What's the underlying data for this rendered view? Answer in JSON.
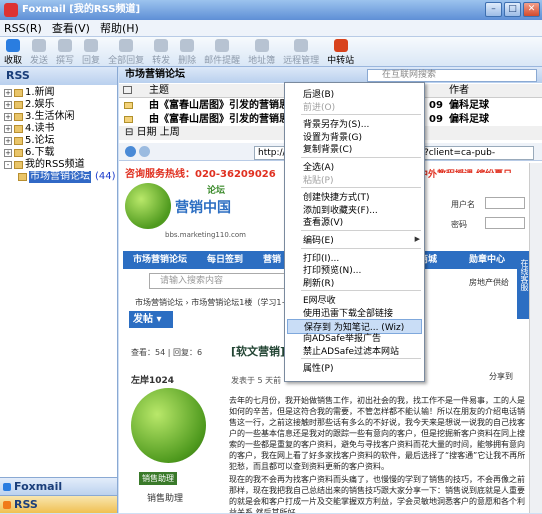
{
  "window": {
    "title": "Foxmail [我的RSS频道]"
  },
  "menubar": [
    "RSS(R)",
    "查看(V)",
    "帮助(H)"
  ],
  "toolbar": [
    {
      "label": "收取",
      "state": "enabled",
      "icon": "receive-icon",
      "color": "#2a7de0"
    },
    {
      "label": "发送",
      "state": "disabled",
      "icon": "send-icon"
    },
    {
      "label": "撰写",
      "state": "disabled",
      "icon": "compose-icon"
    },
    {
      "label": "回复",
      "state": "disabled",
      "icon": "reply-icon"
    },
    {
      "label": "全部回复",
      "state": "disabled",
      "icon": "reply-all-icon"
    },
    {
      "label": "转发",
      "state": "disabled",
      "icon": "forward-icon"
    },
    {
      "label": "删除",
      "state": "disabled",
      "icon": "delete-icon"
    },
    {
      "label": "邮件提醒",
      "state": "disabled",
      "icon": "mail-alert-icon"
    },
    {
      "label": "地址簿",
      "state": "disabled",
      "icon": "address-book-icon"
    },
    {
      "label": "远程管理",
      "state": "disabled",
      "icon": "remote-admin-icon"
    },
    {
      "label": "中转站",
      "state": "enabled",
      "icon": "transfer-station-icon",
      "color": "#d8421c"
    }
  ],
  "sidebar": {
    "title": "RSS",
    "tree": [
      {
        "label": "1.新闻",
        "indent": 0,
        "expander": "+"
      },
      {
        "label": "2.娱乐",
        "indent": 0,
        "expander": "+"
      },
      {
        "label": "3.生活休闲",
        "indent": 0,
        "expander": "+"
      },
      {
        "label": "4.读书",
        "indent": 0,
        "expander": "+"
      },
      {
        "label": "5.论坛",
        "indent": 0,
        "expander": "+"
      },
      {
        "label": "6.下载",
        "indent": 0,
        "expander": "+"
      },
      {
        "label": "我的RSS频道",
        "indent": 0,
        "expander": "-"
      },
      {
        "label": "市场营销论坛",
        "indent": 1,
        "expander": "",
        "count": "(44)",
        "selected": true
      }
    ],
    "bottom_tabs": [
      {
        "label": "Foxmail",
        "active": false
      },
      {
        "label": "RSS",
        "active": true
      }
    ]
  },
  "feed": {
    "title": "市场营销论坛",
    "search_placeholder": "在互联网搜索",
    "columns": {
      "subject": "主题",
      "author": "作者"
    },
    "rows": [
      {
        "subject": "由《富春山居图》引发的营销思考",
        "date": "09",
        "author": "偏科足球"
      },
      {
        "subject": "由《富春山居图》引发的营销思考",
        "date": "09",
        "author": "偏科足球"
      }
    ],
    "group": {
      "label": "日期",
      "value": "上周"
    }
  },
  "address": {
    "value": "http://g",
    "tail": "/ads?client=ca-pub-"
  },
  "web": {
    "hotline": "咨询服务热线：020-36209026",
    "logo_text": "营销中国",
    "logo_sub": "论坛",
    "logo_url": "bbs.marketing110.com",
    "banner": "中外教程授课  缤纷夏日",
    "nav": [
      "市场营销论坛",
      "每日签到",
      "营销",
      "商城",
      "勋章中心"
    ],
    "search_placeholder": "请输入搜索内容",
    "crumb": "市场营销论坛 › 市场营销论坛1楼（学习1+1）› 综合  营销方法",
    "post_button": "发帖",
    "stats": "查看：54 | 回复：6",
    "post_title": "[软文营销] 给",
    "author": "左岸1024",
    "posted": "发表于 5 天前",
    "share": "分享到",
    "paragraph1": "去年的七月份，我开始做销售工作，初出社会的我，找工作不是一件易事，工的人是如何的辛苦，但是这符合我的需要，不管怎样都不能认输！所以在朋友的介绍电话销售这一行，之前这接触时那些话有多么的不好说，我今天来是想说一说我的自己找客户的一些基本信息还是我对的跟踪一些有意向的客户，但是挖掘新客户资料在同上搜索的一些都是重复的客户资料，避免与寻找客户资料而花大量的时间，能够拥有意向的客户，我在网上看了好多家找客户资料的软件，最后选择了“搜客通”它让我不再所犯愁，而且都可以查到资料更新的客户资料。",
    "paragraph2": "现在的我不会再为找客户资料而头痛了，也慢慢的学到了销售的技巧，不会再像之前那样，现在我把我自己总结出来的销售技巧跟大家分享一下：销售说到底就是人重要的就是会和客户打成一片及交能掌握双方利益，学会灵敏地洞悉客户的意愿和各个利益关系,然后其所好。",
    "badge": "销售助理",
    "rank": "销售助理",
    "login_labels": [
      "用户名",
      "密码"
    ],
    "right_tab": "在线客服",
    "housing": "房地产供给"
  },
  "context_menu": [
    {
      "label": "后退(B)",
      "state": "enabled"
    },
    {
      "label": "前进(O)",
      "state": "disabled"
    },
    {
      "sep": true
    },
    {
      "label": "背景另存为(S)...",
      "state": "enabled"
    },
    {
      "label": "设置为背景(G)",
      "state": "enabled"
    },
    {
      "label": "复制背景(C)",
      "state": "enabled"
    },
    {
      "sep": true
    },
    {
      "label": "全选(A)",
      "state": "enabled"
    },
    {
      "label": "粘贴(P)",
      "state": "disabled"
    },
    {
      "sep": true
    },
    {
      "label": "创建快捷方式(T)",
      "state": "enabled"
    },
    {
      "label": "添加到收藏夹(F)...",
      "state": "enabled"
    },
    {
      "label": "查看源(V)",
      "state": "enabled"
    },
    {
      "sep": true
    },
    {
      "label": "编码(E)",
      "state": "enabled",
      "submenu": true
    },
    {
      "sep": true
    },
    {
      "label": "打印(I)...",
      "state": "enabled"
    },
    {
      "label": "打印预览(N)...",
      "state": "enabled"
    },
    {
      "label": "刷新(R)",
      "state": "enabled"
    },
    {
      "sep": true
    },
    {
      "label": "E网尽收",
      "state": "enabled"
    },
    {
      "label": "使用迅雷下载全部链接",
      "state": "enabled"
    },
    {
      "label": "保存到 为知笔记... (Wiz)",
      "state": "highlighted"
    },
    {
      "label": "向ADSafe举报广告",
      "state": "enabled"
    },
    {
      "label": "禁止ADSafe过滤本网站",
      "state": "enabled"
    },
    {
      "sep": true
    },
    {
      "label": "属性(P)",
      "state": "enabled"
    }
  ]
}
